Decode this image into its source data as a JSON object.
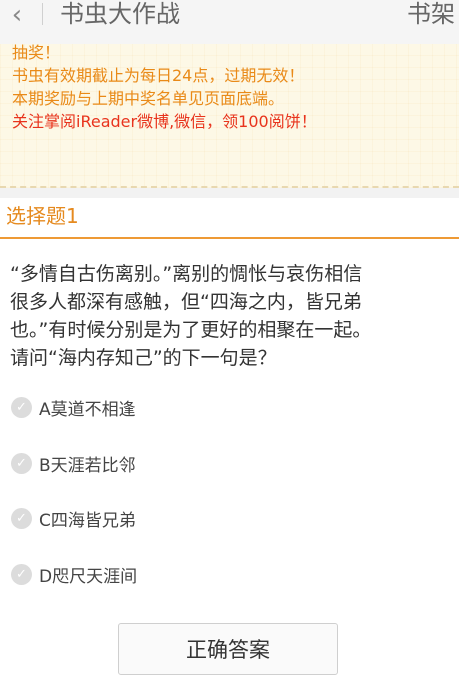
{
  "header": {
    "back_icon": "chevron-left-icon",
    "title": "书虫大作战",
    "right_link": "书架"
  },
  "notice": {
    "lines": [
      {
        "text": "抽奖！",
        "color": "#e98a18"
      },
      {
        "text": "书虫有效期截止为每日24点，过期无效！",
        "color": "#e98a18"
      },
      {
        "text": "本期奖励与上期中奖名单见页面底端。",
        "color": "#e98a18"
      },
      {
        "text": "关注掌阅iReader微博,微信，领100阅饼！",
        "color": "#e8331c"
      }
    ]
  },
  "quiz": {
    "section_title": "选择题1",
    "question_lines": [
      "“多情自古伤离别。”离别的惆怅与哀伤相信",
      "很多人都深有感触，但“四海之内，皆兄弟",
      "也。”有时候分别是为了更好的相聚在一起。",
      "请问“海内存知己”的下一句是？"
    ],
    "options": [
      {
        "label": "A莫道不相逢"
      },
      {
        "label": "B天涯若比邻"
      },
      {
        "label": "C四海皆兄弟"
      },
      {
        "label": "D咫尺天涯间"
      }
    ],
    "answer_button": "正确答案"
  },
  "colors": {
    "accent": "#e58a1f",
    "notice_bg": "#fdf8e6",
    "notice_red": "#e8331c"
  }
}
